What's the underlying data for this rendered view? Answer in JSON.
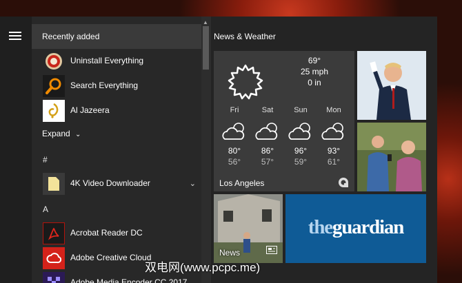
{
  "start_menu": {
    "recently_added_label": "Recently added",
    "recent_apps": [
      {
        "label": "Uninstall Everything",
        "icon": "uninstall-icon"
      },
      {
        "label": "Search Everything",
        "icon": "magnifier-icon"
      },
      {
        "label": "Al Jazeera",
        "icon": "al-jazeera-logo-icon"
      }
    ],
    "expand_label": "Expand",
    "sections": [
      {
        "letter": "#",
        "apps": [
          {
            "label": "4K Video Downloader",
            "icon": "folder-icon"
          }
        ]
      },
      {
        "letter": "A",
        "apps": [
          {
            "label": "Acrobat Reader DC",
            "icon": "acrobat-icon"
          },
          {
            "label": "Adobe Creative Cloud",
            "icon": "creative-cloud-icon"
          },
          {
            "label": "Adobe Media Encoder CC 2017",
            "icon": "media-encoder-icon"
          }
        ]
      }
    ]
  },
  "tiles": {
    "group_title": "News & Weather",
    "weather": {
      "current": {
        "temp": "69°",
        "wind": "25 mph",
        "precip": "0 in"
      },
      "forecast": [
        {
          "day": "Fri",
          "high": "80°",
          "low": "56°"
        },
        {
          "day": "Sat",
          "high": "86°",
          "low": "57°"
        },
        {
          "day": "Sun",
          "high": "96°",
          "low": "59°"
        },
        {
          "day": "Mon",
          "high": "93°",
          "low": "61°"
        }
      ],
      "city": "Los Angeles"
    },
    "news_label": "News",
    "guardian": {
      "the": "the",
      "name": "guardian"
    }
  },
  "watermark": "双电网(www.pcpc.me)",
  "colors": {
    "accent_blue": "#0f5b96",
    "tile_gray": "#3b3b3b",
    "menu_bg": "#242424"
  }
}
